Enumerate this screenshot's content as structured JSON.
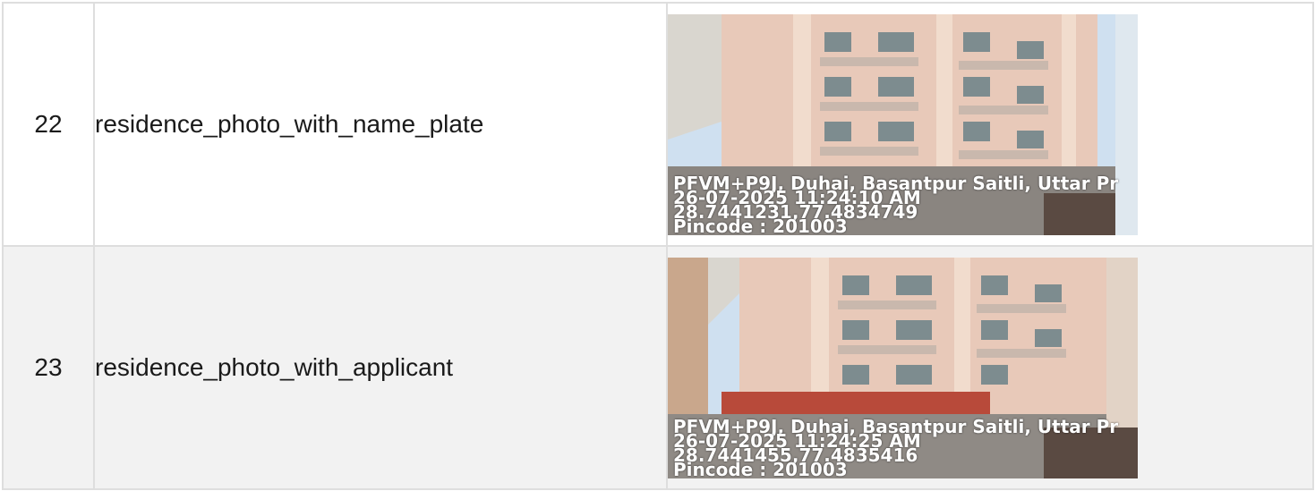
{
  "rows": [
    {
      "number": "22",
      "field": "residence_photo_with_name_plate",
      "photo": {
        "alt": "residence_photo_with_name_plate",
        "stamp_address": "PFVM+P9J, Duhai, Basantpur Saitli, Uttar Pr",
        "stamp_datetime": "26-07-2025 11:24:10 AM",
        "stamp_coords": "28.7441231,77.4834749",
        "stamp_pincode": "Pincode : 201003"
      }
    },
    {
      "number": "23",
      "field": "residence_photo_with_applicant",
      "photo": {
        "alt": "residence_photo_with_applicant",
        "stamp_address": "PFVM+P9J, Duhai, Basantpur Saitli, Uttar Pr",
        "stamp_datetime": "26-07-2025 11:24:25 AM",
        "stamp_coords": "28.7441455,77.4835416",
        "stamp_pincode": "Pincode : 201003"
      }
    }
  ],
  "colors": {
    "border": "#dedede",
    "row_alt_bg": "#f2f2f2",
    "building": "#e8c9b9",
    "sky": "#cfe0f0"
  }
}
